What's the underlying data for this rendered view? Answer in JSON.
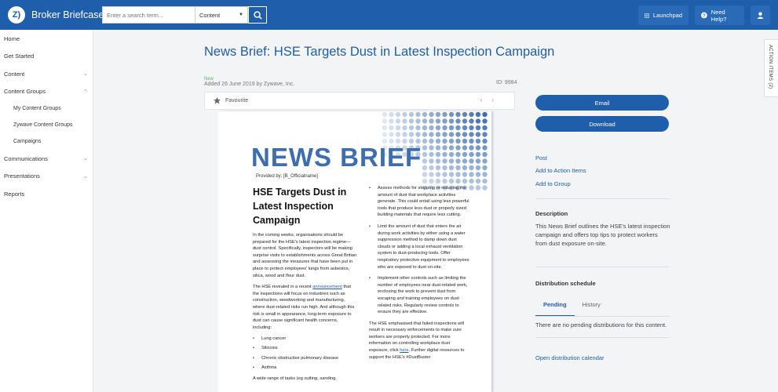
{
  "topbar": {
    "logo_text": "Z)",
    "brand": "Broker Briefcase",
    "brand_mark": "®",
    "search_placeholder": "Enter a search term...",
    "search_scope": "Content",
    "launchpad": "Launchpad",
    "help": "Need Help?"
  },
  "sidebar": {
    "items": [
      {
        "label": "Home"
      },
      {
        "label": "Get Started"
      },
      {
        "label": "Content"
      },
      {
        "label": "Content Groups"
      },
      {
        "label": "My Content Groups"
      },
      {
        "label": "Zywave Content Groups"
      },
      {
        "label": "Campaigns"
      },
      {
        "label": "Communications"
      },
      {
        "label": "Presentations"
      },
      {
        "label": "Reports"
      }
    ]
  },
  "page": {
    "title": "News Brief: HSE Targets Dust in Latest Inspection Campaign",
    "new_tag": "New",
    "added": "Added 26 June 2019 by Zywave, Inc.",
    "id": "ID: 9984",
    "favourite": "Favourite"
  },
  "doc": {
    "heading": "NEWS BRIEF",
    "provided": "Provided by: [B_Officialname]",
    "article_title": "HSE Targets Dust in Latest Inspection Campaign",
    "p1": "In the coming weeks, organisations should be prepared for the HSE's latest inspection regime—dust control. Specifically, inspectors will be making surprise visits to establishments across Great Britian and assessing the measures that have been put in place to protect employees' lungs from asbestos, silica, wood and flour dust.",
    "p2_a": "The HSE revealed in a recent ",
    "p2_link": "announcement",
    "p2_b": " that the inspections will focus on industries such as construction, woodworking and manufacturing, where dust-related risks run high. And although this risk is small in appearance, long-term exposure to dust can cause significant health concerns, including:",
    "bullets": [
      "Lung cancer",
      "Silicosis",
      "Chronic obstructive pulmonary disease",
      "Asthma"
    ],
    "p3": "A wide range of tasks (eg cutting, sanding,",
    "r1": "Assess methods for stopping or reducing the amount of dust that workplace activities generate. This could entail using less powerful tools that produce less dust or properly sized building materials that require less cutting.",
    "r2": "Limit the amount of dust that enters the air during work activities by either using a water suppression method to damp down dust clouds or adding a local exhaust ventilation system to dust-producing tools. Offer respiratory protective equipment to employees who are exposed to dust on-site.",
    "r3": "Implement other controls such as limiting the number of employees near dust-related work, enclosing the work to prevent dust from escaping and training employees on dust-related risks. Regularly review controls to ensure they are effective.",
    "r4_a": "The HSE emphasised that failed inspections will result in necessary enforcements to make sure workers are properly protected. For more information on controlling workplace dust exposure, click ",
    "r4_link": "here",
    "r4_b": ". Further digital resources to support the HSE's #DustBuster"
  },
  "actions": {
    "email": "Email",
    "download": "Download",
    "post": "Post",
    "add_action": "Add to Action Items",
    "add_group": "Add to Group",
    "description_label": "Description",
    "description": "This News Brief outlines the HSE's latest inspection campaign and offers top tips to protect workers from dust exposure on-site.",
    "distribution_label": "Distribution schedule",
    "tab_pending": "Pending",
    "tab_history": "History",
    "pending_text": "There are no pending distributions for this content.",
    "calendar": "Open distribution calendar",
    "action_items_tab": "ACTION ITEMS (2)"
  },
  "colors": {
    "brand_blue": "#1f5eab",
    "new_green": "#5cb85c",
    "doc_blue": "#3d6eb0"
  },
  "icons": [
    "search-icon",
    "grid-icon",
    "help-icon",
    "user-icon",
    "star-icon",
    "chevron-down-icon",
    "arrow-left-icon",
    "arrow-right-icon"
  ]
}
